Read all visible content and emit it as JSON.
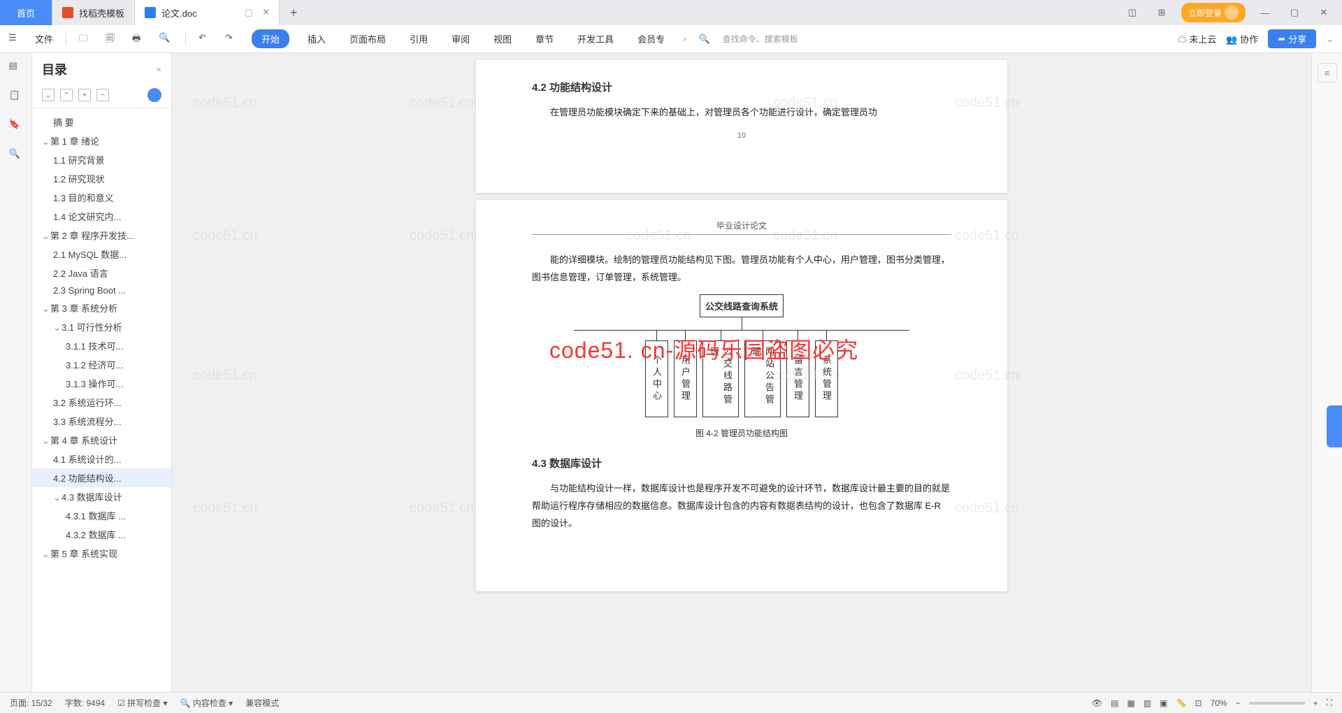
{
  "tabs": {
    "home": "首页",
    "t1": "找稻壳模板",
    "t2": "论文.doc"
  },
  "login": "立即登录",
  "toolbar": {
    "file": "文件"
  },
  "menu": [
    "开始",
    "插入",
    "页面布局",
    "引用",
    "审阅",
    "视图",
    "章节",
    "开发工具",
    "会员专"
  ],
  "search_hint": "查找命令、搜索模板",
  "cloud": "未上云",
  "collab": "协作",
  "share": "分享",
  "outline": {
    "title": "目录"
  },
  "toc": [
    {
      "t": "摘 要",
      "l": 2
    },
    {
      "t": "第 1 章 绪论",
      "l": 1,
      "c": 1
    },
    {
      "t": "1.1 研究背景",
      "l": 2
    },
    {
      "t": "1.2 研究现状",
      "l": 2
    },
    {
      "t": "1.3 目的和意义",
      "l": 2
    },
    {
      "t": "1.4 论文研究内...",
      "l": 2
    },
    {
      "t": "第 2 章 程序开发技...",
      "l": 1,
      "c": 1
    },
    {
      "t": "2.1 MySQL 数据...",
      "l": 2
    },
    {
      "t": "2.2 Java 语言",
      "l": 2
    },
    {
      "t": "2.3 Spring Boot ...",
      "l": 2
    },
    {
      "t": "第 3 章 系统分析",
      "l": 1,
      "c": 1
    },
    {
      "t": "3.1 可行性分析",
      "l": 2,
      "c": 1
    },
    {
      "t": "3.1.1 技术可...",
      "l": 3
    },
    {
      "t": "3.1.2 经济可...",
      "l": 3
    },
    {
      "t": "3.1.3 操作可...",
      "l": 3
    },
    {
      "t": "3.2 系统运行环...",
      "l": 2
    },
    {
      "t": "3.3 系统流程分...",
      "l": 2
    },
    {
      "t": "第 4 章 系统设计",
      "l": 1,
      "c": 1
    },
    {
      "t": "4.1 系统设计的...",
      "l": 2
    },
    {
      "t": "4.2 功能结构设...",
      "l": 2,
      "sel": 1
    },
    {
      "t": "4.3 数据库设计",
      "l": 2,
      "c": 1
    },
    {
      "t": "4.3.1 数据库 ...",
      "l": 3
    },
    {
      "t": "4.3.2 数据库 ...",
      "l": 3
    },
    {
      "t": "第 5 章 系统实现",
      "l": 1,
      "c": 1
    }
  ],
  "doc": {
    "sect42": "4.2 功能结构设计",
    "p1": "在管理员功能模块确定下来的基础上，对管理员各个功能进行设计，确定管理员功",
    "pn": "10",
    "hdr": "毕业设计论文",
    "p2": "能的详细模块。绘制的管理员功能结构见下图。管理员功能有个人中心，用户管理，图书分类管理，图书信息管理，订单管理，系统管理。",
    "org_root": "公交线路查询系统",
    "org": [
      "个人中心",
      "用户管理",
      "公交线路管理",
      "网站公告管理",
      "留言管理",
      "系统管理"
    ],
    "figcap": "图 4-2 管理员功能结构图",
    "sect43": "4.3 数据库设计",
    "p3": "与功能结构设计一样，数据库设计也是程序开发不可避免的设计环节，数据库设计最主要的目的就是帮助运行程序存储相应的数据信息。数据库设计包含的内容有数据表结构的设计，也包含了数据库 E-R 图的设计。"
  },
  "red_banner": "code51. cn-源码乐园盗图必究",
  "watermark": "code51.cn",
  "status": {
    "page": "页面: 15/32",
    "words": "字数: 9494",
    "spell": "拼写检查",
    "content": "内容检查",
    "compat": "兼容模式",
    "zoom": "70%"
  }
}
